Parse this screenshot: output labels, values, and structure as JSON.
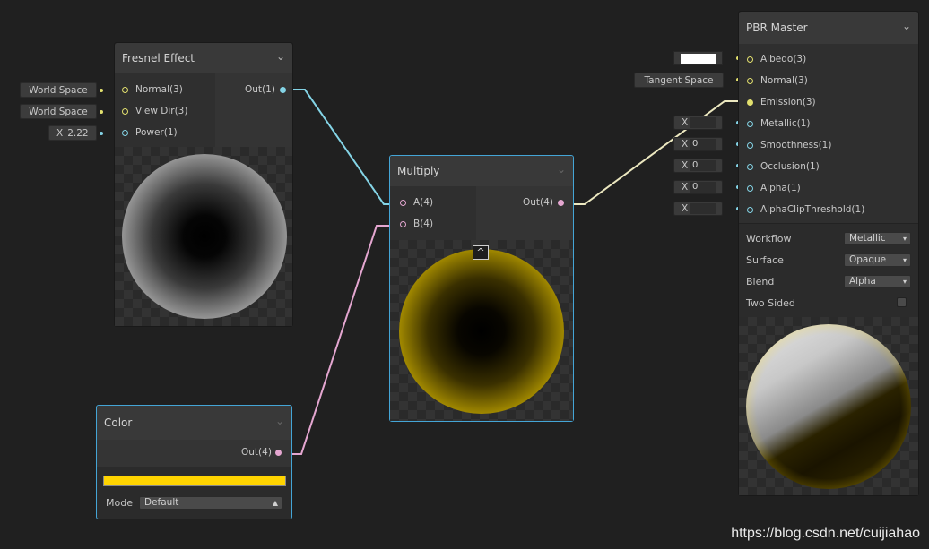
{
  "fresnel": {
    "title": "Fresnel Effect",
    "inputs": [
      "Normal(3)",
      "View Dir(3)",
      "Power(1)"
    ],
    "output": "Out(1)",
    "defaults": [
      "World Space",
      "World Space"
    ],
    "power_prefix": "X",
    "power_value": "2.22"
  },
  "multiply": {
    "title": "Multiply",
    "inputs": [
      "A(4)",
      "B(4)"
    ],
    "output": "Out(4)",
    "collapse_glyph": "^"
  },
  "color_node": {
    "title": "Color",
    "output": "Out(4)",
    "swatch_color": "#FFD400",
    "mode_label": "Mode",
    "mode_value": "Default"
  },
  "pbr": {
    "title": "PBR Master",
    "inputs": [
      "Albedo(3)",
      "Normal(3)",
      "Emission(3)",
      "Metallic(1)",
      "Smoothness(1)",
      "Occlusion(1)",
      "Alpha(1)",
      "AlphaClipThreshold(1)"
    ],
    "normal_default": "Tangent Space",
    "x_prefix": "X",
    "smoothness_value": "0",
    "occlusion_value": "0",
    "alpha_value": "0",
    "settings": {
      "workflow_label": "Workflow",
      "workflow_value": "Metallic",
      "surface_label": "Surface",
      "surface_value": "Opaque",
      "blend_label": "Blend",
      "blend_value": "Alpha",
      "two_sided_label": "Two Sided"
    }
  },
  "colors": {
    "background": "#202020",
    "vector1_port": "#84D4E6",
    "vector3_port": "#E2E06E",
    "vector4_port": "#E4A6D0",
    "selection": "#44A5D6"
  },
  "watermark": "https://blog.csdn.net/cuijiahao"
}
